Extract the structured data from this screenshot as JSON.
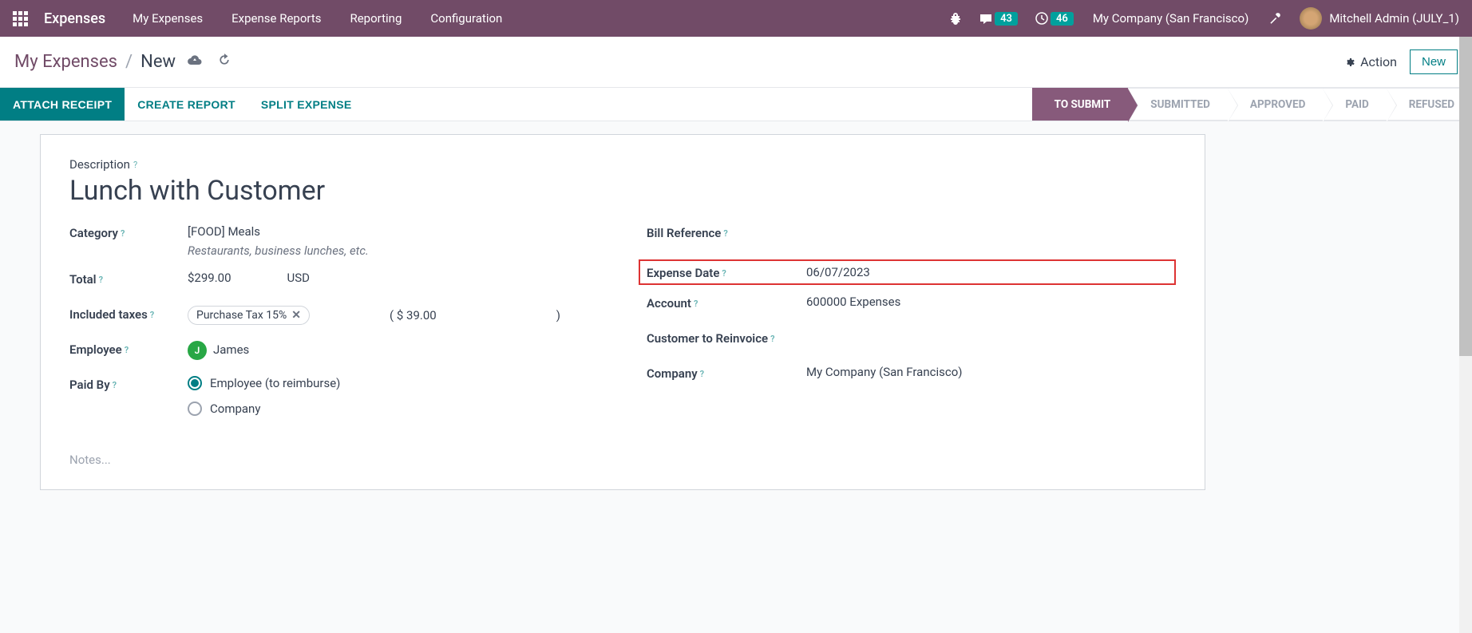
{
  "topbar": {
    "app_name": "Expenses",
    "menu": [
      "My Expenses",
      "Expense Reports",
      "Reporting",
      "Configuration"
    ],
    "msg_badge": "43",
    "activity_badge": "46",
    "company": "My Company (San Francisco)",
    "user": "Mitchell Admin (JULY_1)"
  },
  "breadcrumb": {
    "parent": "My Expenses",
    "current": "New"
  },
  "actions": {
    "action_label": "Action",
    "new_label": "New"
  },
  "toolbar": {
    "attach": "ATTACH RECEIPT",
    "create": "CREATE REPORT",
    "split": "SPLIT EXPENSE"
  },
  "statuses": [
    "TO SUBMIT",
    "SUBMITTED",
    "APPROVED",
    "PAID",
    "REFUSED"
  ],
  "form": {
    "desc_label": "Description",
    "desc_value": "Lunch with Customer",
    "left": {
      "category_label": "Category",
      "category_value": "[FOOD] Meals",
      "category_hint": "Restaurants, business lunches, etc.",
      "total_label": "Total",
      "total_value": "$299.00",
      "total_currency": "USD",
      "taxes_label": "Included taxes",
      "tax_tag": "Purchase Tax 15%",
      "tax_amount_open": "( $",
      "tax_amount": "39.00",
      "tax_amount_close": ")",
      "employee_label": "Employee",
      "employee_initial": "J",
      "employee_name": "James",
      "paidby_label": "Paid By",
      "paidby_opt1": "Employee (to reimburse)",
      "paidby_opt2": "Company"
    },
    "right": {
      "billref_label": "Bill Reference",
      "date_label": "Expense Date",
      "date_value": "06/07/2023",
      "account_label": "Account",
      "account_value": "600000 Expenses",
      "reinvoice_label": "Customer to Reinvoice",
      "company_label": "Company",
      "company_value": "My Company (San Francisco)"
    },
    "notes_placeholder": "Notes..."
  }
}
